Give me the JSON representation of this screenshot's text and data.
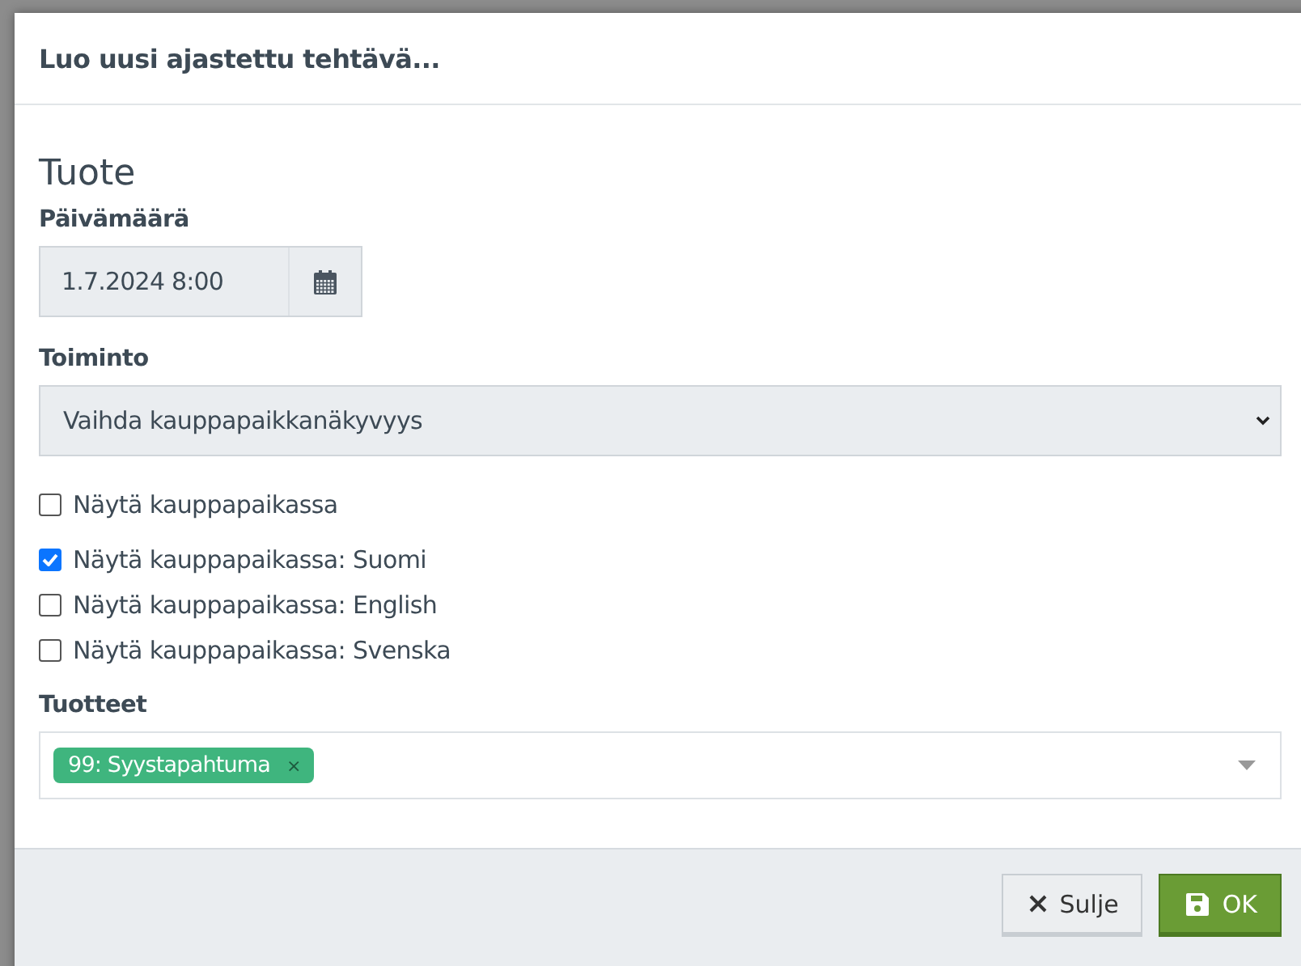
{
  "dialog": {
    "title": "Luo uusi ajastettu tehtävä..."
  },
  "section_title": "Tuote",
  "date": {
    "label": "Päivämäärä",
    "value": "1.7.2024 8:00"
  },
  "action": {
    "label": "Toiminto",
    "value": "Vaihda kauppapaikkanäkyvyys"
  },
  "checkboxes": [
    {
      "label": "Näytä kauppapaikassa",
      "checked": false
    },
    {
      "label": "Näytä kauppapaikassa: Suomi",
      "checked": true
    },
    {
      "label": "Näytä kauppapaikassa: English",
      "checked": false
    },
    {
      "label": "Näytä kauppapaikassa: Svenska",
      "checked": false
    }
  ],
  "products": {
    "label": "Tuotteet",
    "tags": [
      {
        "label": "99: Syystapahtuma",
        "remove": "×"
      }
    ]
  },
  "buttons": [
    {
      "kind": "close",
      "label": "Sulje"
    },
    {
      "kind": "ok",
      "label": "OK"
    }
  ]
}
